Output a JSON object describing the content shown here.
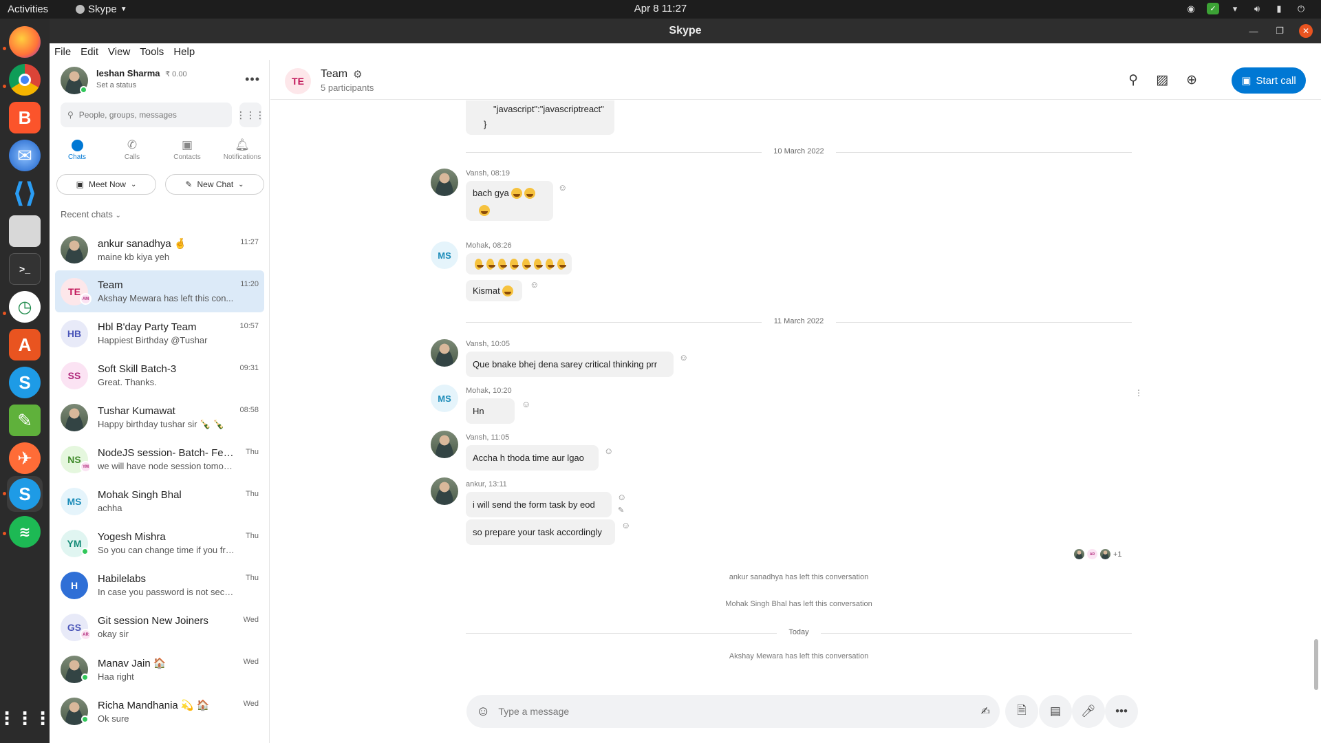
{
  "topbar": {
    "activities": "Activities",
    "app_name": "Skype",
    "clock": "Apr 8  11:27"
  },
  "window": {
    "title": "Skype"
  },
  "menu": [
    "File",
    "Edit",
    "View",
    "Tools",
    "Help"
  ],
  "profile": {
    "name": "Ieshan Sharma",
    "balance": "₹ 0.00",
    "status": "Set a status"
  },
  "search": {
    "placeholder": "People, groups, messages"
  },
  "tabs": [
    {
      "label": "Chats",
      "icon": "chat-icon"
    },
    {
      "label": "Calls",
      "icon": "phone-icon"
    },
    {
      "label": "Contacts",
      "icon": "contacts-icon"
    },
    {
      "label": "Notifications",
      "icon": "bell-icon"
    }
  ],
  "buttons": {
    "meet_now": "Meet Now",
    "new_chat": "New Chat",
    "start_call": "Start call"
  },
  "recent_label": "Recent chats",
  "chats": [
    {
      "name": "ankur sanadhya 🤞",
      "preview": "maine kb kiya yeh",
      "time": "11:27",
      "initials": "",
      "color": "#6d8b5e",
      "photo": true
    },
    {
      "name": "Team",
      "preview": "Akshay Mewara has left this con...",
      "time": "11:20",
      "initials": "TE",
      "color": "#fde7ea",
      "fg": "#c2185b",
      "mini": "AM",
      "selected": true
    },
    {
      "name": "Hbl B'day Party Team",
      "preview": "Happiest Birthday @Tushar",
      "time": "10:57",
      "initials": "HB",
      "color": "#e8eaf8",
      "fg": "#4a55b8",
      "mini": ""
    },
    {
      "name": "Soft Skill Batch-3",
      "preview": "Great. Thanks.",
      "time": "09:31",
      "initials": "SS",
      "color": "#fbe3f3",
      "fg": "#b0287a",
      "mini": ""
    },
    {
      "name": "Tushar Kumawat",
      "preview": "Happy birthday tushar sir 🍾 🍾",
      "time": "08:58",
      "initials": "",
      "photo": true
    },
    {
      "name": "NodeJS session- Batch- Feb...",
      "preview": "we will have node session tomorr...",
      "time": "Thu",
      "initials": "NS",
      "color": "#e5f7de",
      "fg": "#3f8a2a",
      "mini": "YM"
    },
    {
      "name": "Mohak Singh Bhal",
      "preview": "achha",
      "time": "Thu",
      "initials": "MS",
      "color": "#e5f4fb",
      "fg": "#1a8bb8"
    },
    {
      "name": "Yogesh Mishra",
      "preview": "So you can change time if you fre...",
      "time": "Thu",
      "initials": "YM",
      "color": "#e0f5f1",
      "fg": "#128a76",
      "online": true
    },
    {
      "name": "Habilelabs",
      "preview": "In case you password is not secur...",
      "time": "Thu",
      "initials": "H",
      "color": "#2f6fd6",
      "fg": "#ffffff",
      "mini": ""
    },
    {
      "name": "Git session New Joiners",
      "preview": "okay sir",
      "time": "Wed",
      "initials": "GS",
      "color": "#e8eaf8",
      "fg": "#4a55b8",
      "mini": "AR"
    },
    {
      "name": "Manav Jain 🏠",
      "preview": "Haa right",
      "time": "Wed",
      "initials": "",
      "photo": true,
      "online": true
    },
    {
      "name": "Richa Mandhania 💫 🏠",
      "preview": "Ok sure",
      "time": "Wed",
      "initials": "",
      "photo": true,
      "online": true
    }
  ],
  "conversation": {
    "title": "Team",
    "initials": "TE",
    "participants": "5 participants",
    "code_line": "\"javascript\":\"javascriptreact\"",
    "code_close": "}",
    "date1": "10 March 2022",
    "date2": "11 March 2022",
    "date3": "Today",
    "messages": [
      {
        "sender": "Vansh, 08:19",
        "text": "bach gya"
      },
      {
        "sender": "Mohak, 08:26",
        "text": "",
        "text2": "Kismat"
      },
      {
        "sender": "Vansh, 10:05",
        "text": "Que bnake bhej dena sarey critical thinking prr"
      },
      {
        "sender": "Mohak, 10:20",
        "text": "Hn"
      },
      {
        "sender": "Vansh, 11:05",
        "text": "Accha h thoda time aur lgao"
      },
      {
        "sender": "ankur, 13:11",
        "text": "i will send the form task by eod",
        "text2": "so prepare your task accordingly"
      }
    ],
    "seen_more": "+1",
    "system": [
      "ankur sanadhya has left this conversation",
      "Mohak Singh Bhal has left this conversation",
      "Akshay Mewara has left this conversation"
    ],
    "ms_initials": "MS"
  },
  "composer": {
    "placeholder": "Type a message"
  }
}
